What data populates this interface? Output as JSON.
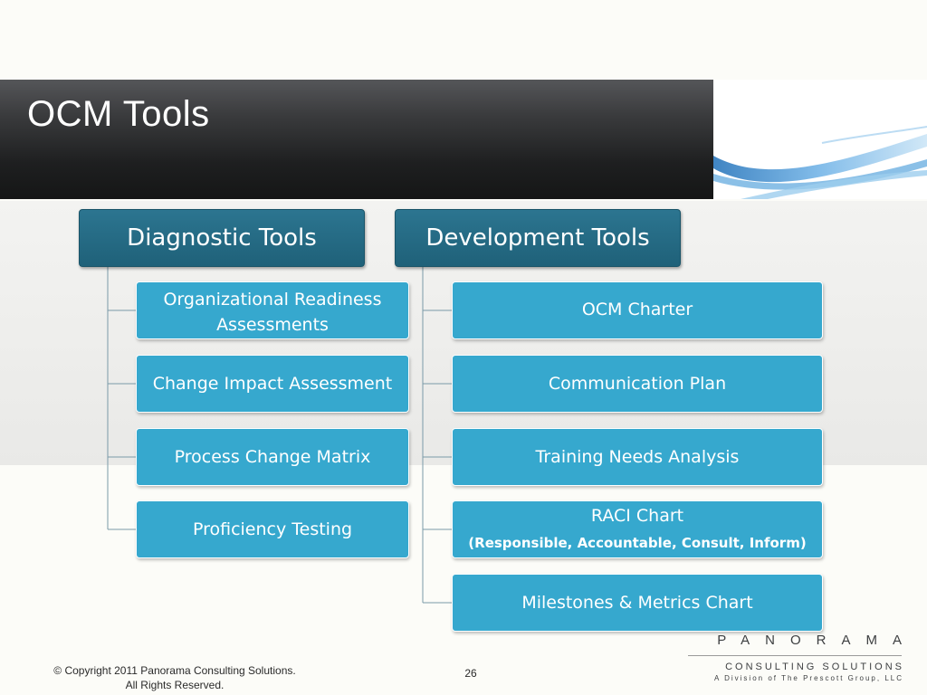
{
  "slide": {
    "title": "OCM Tools",
    "page_number": "26"
  },
  "columns": [
    {
      "header": "Diagnostic Tools",
      "items": [
        {
          "lines": [
            "Organizational Readiness",
            "Assessments"
          ]
        },
        {
          "lines": [
            "Change Impact Assessment"
          ]
        },
        {
          "lines": [
            "Process Change Matrix"
          ]
        },
        {
          "lines": [
            "Proficiency Testing"
          ]
        }
      ]
    },
    {
      "header": "Development Tools",
      "items": [
        {
          "lines": [
            "OCM Charter"
          ]
        },
        {
          "lines": [
            "Communication Plan"
          ]
        },
        {
          "lines": [
            "Training Needs Analysis"
          ]
        },
        {
          "lines": [
            "RACI Chart"
          ],
          "detail": "(Responsible, Accountable, Consult, Inform)"
        },
        {
          "lines": [
            "Milestones & Metrics Chart"
          ]
        }
      ]
    }
  ],
  "footer": {
    "copyright_line1": "© Copyright 2011 Panorama Consulting Solutions.",
    "copyright_line2": "All Rights Reserved.",
    "logo_name": "PANORAMA",
    "logo_tagline": "CONSULTING SOLUTIONS",
    "logo_division": "A Division of The Prescott Group, LLC"
  },
  "colors": {
    "header_box": "#236a84",
    "node_box": "#36a8ce",
    "title_bar": "#1e1f20"
  }
}
